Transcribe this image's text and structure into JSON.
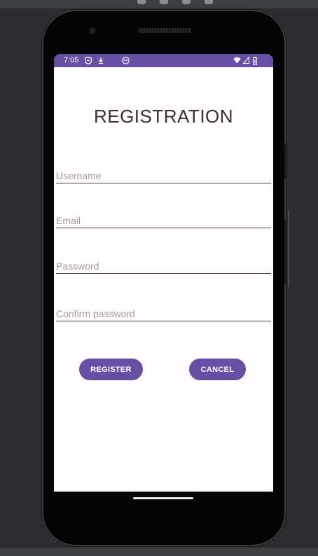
{
  "status_bar": {
    "time": "7:05",
    "icons": [
      "shield-icon",
      "download-icon",
      "face-icon",
      "wifi-icon",
      "signal-icon",
      "battery-icon"
    ],
    "color": "#6750a4"
  },
  "form": {
    "title": "REGISTRATION",
    "fields": {
      "username": {
        "placeholder": "Username",
        "value": ""
      },
      "email": {
        "placeholder": "Email",
        "value": ""
      },
      "password": {
        "placeholder": "Password",
        "value": ""
      },
      "confirm_password": {
        "placeholder": "Confirm password",
        "value": ""
      }
    },
    "buttons": {
      "register": "REGISTER",
      "cancel": "CANCEL"
    },
    "accent_color": "#6750a4"
  }
}
